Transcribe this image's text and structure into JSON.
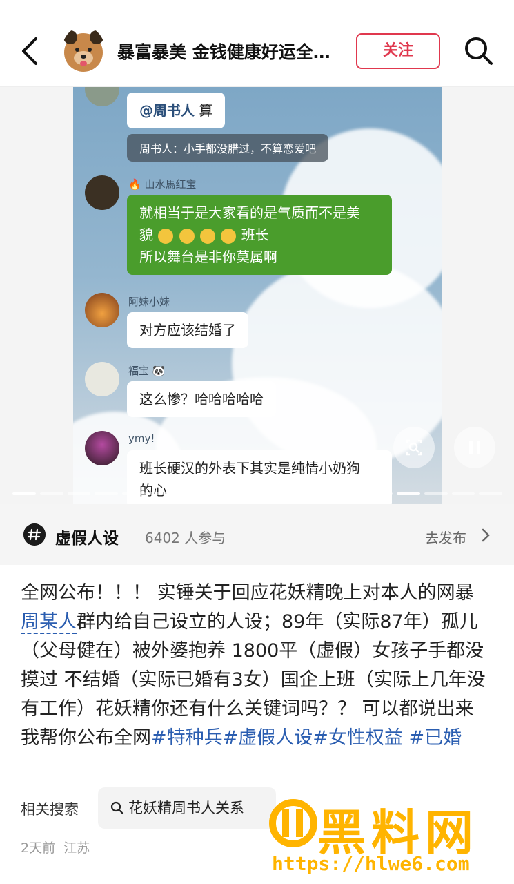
{
  "header": {
    "title": "暴富暴美 金钱健康好运全…",
    "follow_label": "关注"
  },
  "chat": {
    "mention_bubble": {
      "mention": "@周书人",
      "text": " 算"
    },
    "system_reply": "周书人：小手都没腊过，不算恋爱吧",
    "msg1": {
      "nick": "山水馬红宝",
      "line1": "就相当于是大家看的是气质而不是美",
      "line2a": "貌",
      "line2b": "班长",
      "line3": "所以舞台是非你莫属啊"
    },
    "msg2": {
      "nick": "阿妹小妹",
      "text": "对方应该结婚了"
    },
    "msg3": {
      "nick": "福宝",
      "text": "这么惨？哈哈哈哈哈"
    },
    "msg4": {
      "nick": "ymy!",
      "line1": "班长硬汉的外表下其实是纯情小奶狗",
      "line2": "的心"
    }
  },
  "topic": {
    "name": "虚假人设",
    "count": "6402 人参与",
    "publish_label": "去发布"
  },
  "post": {
    "text1": "全网公布！！！ 实锤关于回应花妖精晚上对本人的网暴 ",
    "person": "周某人",
    "text2": "群内给自己设立的人设；89年（实际87年）孤儿（父母健在）被外婆抱养 1800平（虚假）女孩子手都没摸过 不结婚（实际已婚有3女）国企上班（实际上几年没有工作）花妖精你还有什么关键词吗？？ 可以都说出来 我帮你公布全网",
    "tag1": "#特种兵",
    "tag2": "#虚假人设",
    "tag3": "#女性权益",
    "tag4": "#已婚"
  },
  "related": {
    "label": "相关搜索",
    "query": "花妖精周书人关系"
  },
  "meta": {
    "time": "2天前",
    "location": "江苏"
  },
  "watermark": {
    "brand": "黑料网",
    "url": "https://hlwe6.com"
  },
  "icons": [
    "back-arrow-icon",
    "search-icon",
    "scan-icon",
    "pause-icon",
    "hashtag-icon",
    "chevron-right-icon",
    "magnifier-icon"
  ],
  "colors": {
    "accent": "#e0384e",
    "link": "#2a5db0",
    "chat_green": "#4a9d2c",
    "watermark": "#ffb400"
  }
}
